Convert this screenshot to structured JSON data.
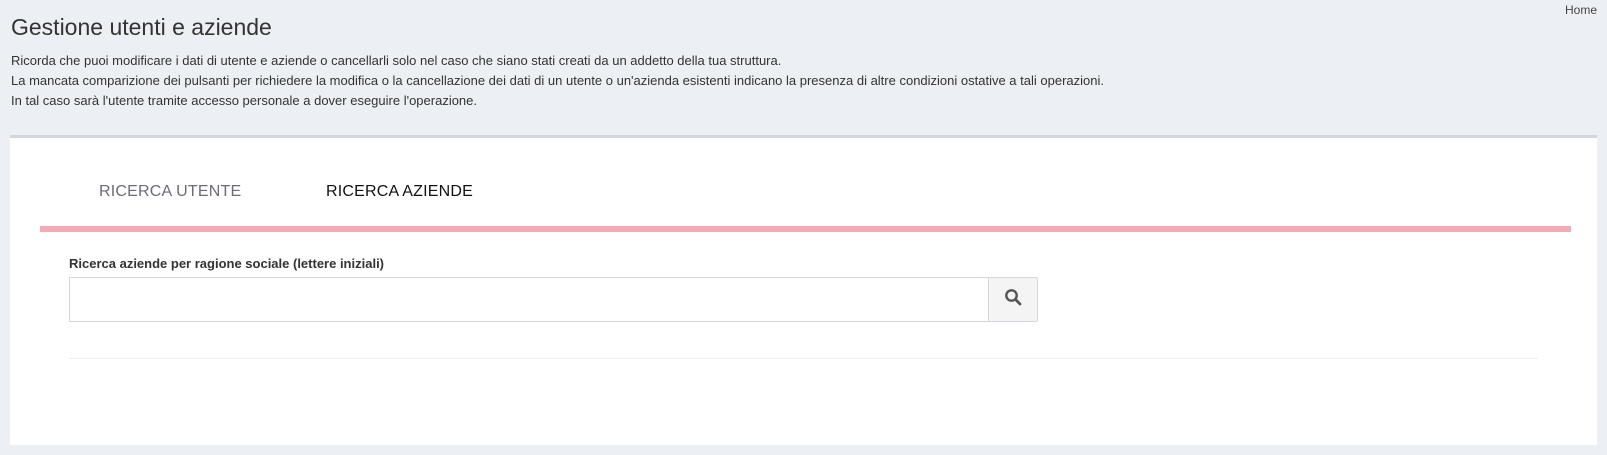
{
  "header": {
    "title": "Gestione utenti e aziende",
    "breadcrumb": "Home"
  },
  "intro": {
    "line1": "Ricorda che puoi modificare i dati di utente e aziende o cancellarli solo nel caso che siano stati creati da un addetto della tua struttura.",
    "line2": "La mancata comparizione dei pulsanti per richiedere la modifica o la cancellazione dei dati di un utente o un'azienda esistenti indicano la presenza di altre condizioni ostative a tali operazioni.",
    "line3": "In tal caso sarà l'utente tramite accesso personale a dover eseguire l'operazione."
  },
  "tabs": [
    {
      "label": "RICERCA UTENTE",
      "active": false
    },
    {
      "label": "RICERCA AZIENDE",
      "active": true
    }
  ],
  "search": {
    "label": "Ricerca aziende per ragione sociale (lettere iniziali)",
    "value": "",
    "placeholder": "",
    "button_icon": "search-icon"
  },
  "colors": {
    "background": "#ecf0f5",
    "tab_underline": "#f4a9b4",
    "card": "#ffffff"
  }
}
